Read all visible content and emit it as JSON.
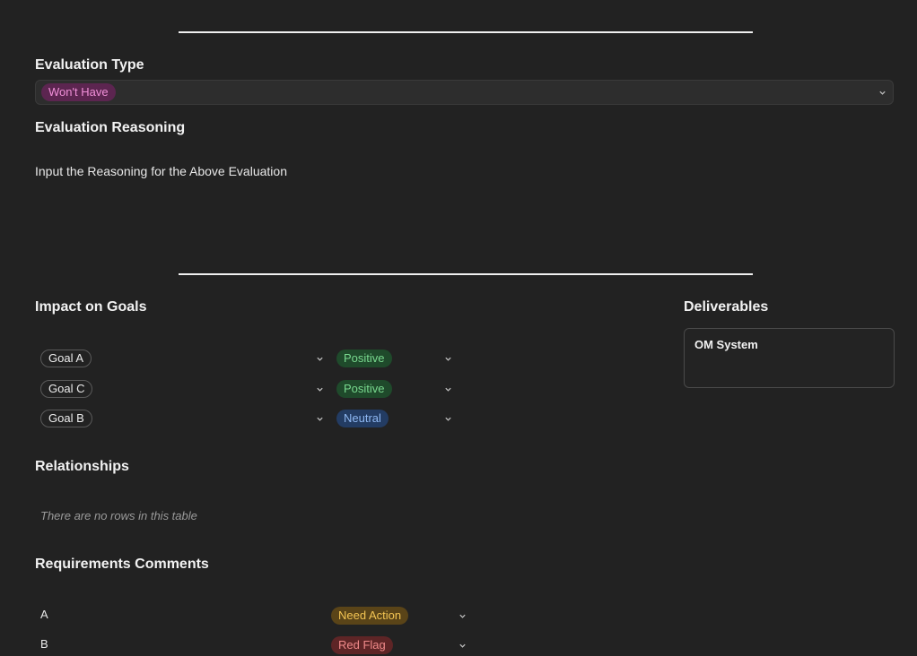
{
  "evaluation": {
    "type_label": "Evaluation Type",
    "type_value": "Won't Have",
    "reasoning_label": "Evaluation Reasoning",
    "reasoning_text": "Input the Reasoning for the Above Evaluation"
  },
  "impact": {
    "title": "Impact on Goals",
    "rows": [
      {
        "goal": "Goal A",
        "impact": "Positive"
      },
      {
        "goal": "Goal C",
        "impact": "Positive"
      },
      {
        "goal": "Goal B",
        "impact": "Neutral"
      }
    ]
  },
  "deliverables": {
    "title": "Deliverables",
    "items": [
      "OM System"
    ]
  },
  "relationships": {
    "title": "Relationships",
    "empty_text": "There are no rows in this table"
  },
  "requirements": {
    "title": "Requirements Comments",
    "rows": [
      {
        "name": "A",
        "status": "Need Action"
      },
      {
        "name": "B",
        "status": "Red Flag"
      }
    ]
  },
  "colors": {
    "background": "#222222",
    "pink_tag": "#5c2550",
    "green_tag": "#1f4a2b",
    "blue_tag": "#233c63",
    "yellow_tag": "#5a4418",
    "red_tag": "#5e2526"
  }
}
